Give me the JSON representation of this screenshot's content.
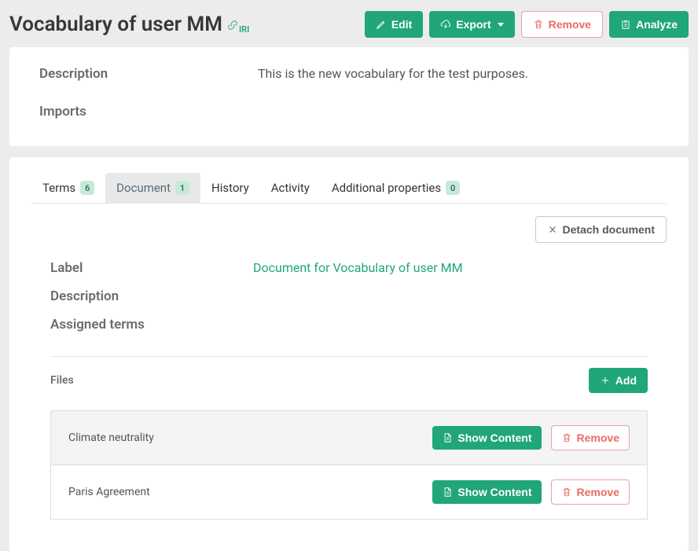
{
  "header": {
    "title": "Vocabulary of user MM",
    "iri_label": "IRI",
    "edit_label": "Edit",
    "export_label": "Export",
    "remove_label": "Remove",
    "analyze_label": "Analyze"
  },
  "details": {
    "description_label": "Description",
    "description_value": "This is the new vocabulary for the test purposes.",
    "imports_label": "Imports",
    "imports_value": ""
  },
  "tabs": {
    "terms_label": "Terms",
    "terms_count": "6",
    "document_label": "Document",
    "document_count": "1",
    "history_label": "History",
    "activity_label": "Activity",
    "additional_label": "Additional properties",
    "additional_count": "0"
  },
  "document": {
    "detach_label": "Detach document",
    "label_label": "Label",
    "label_value": "Document for Vocabulary of user MM",
    "description_label": "Description",
    "description_value": "",
    "assigned_terms_label": "Assigned terms",
    "assigned_terms_value": "",
    "files_label": "Files",
    "add_label": "Add",
    "show_content_label": "Show Content",
    "remove_label": "Remove",
    "files": [
      {
        "name": "Climate neutrality"
      },
      {
        "name": "Paris Agreement"
      }
    ]
  },
  "colors": {
    "accent": "#20a679",
    "danger": "#e86c64"
  }
}
